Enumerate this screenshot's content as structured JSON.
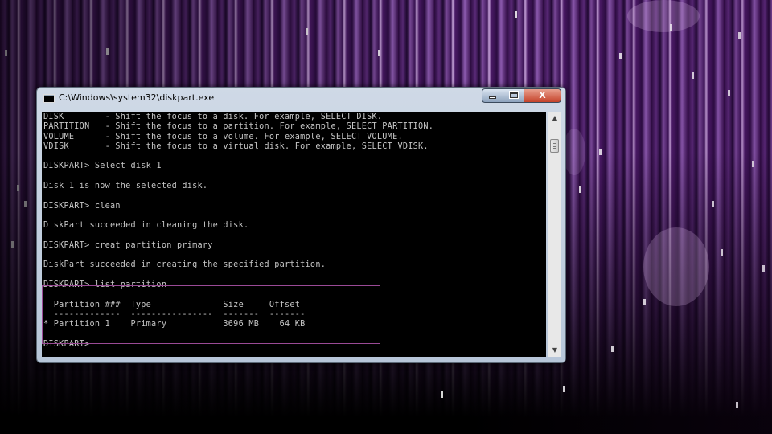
{
  "window": {
    "title": "C:\\Windows\\system32\\diskpart.exe",
    "close_glyph": "X",
    "icon": "console-app-icon"
  },
  "scrollbar": {
    "up_glyph": "▲",
    "down_glyph": "▼"
  },
  "console": {
    "help_lines": [
      "DISK        - Shift the focus to a disk. For example, SELECT DISK.",
      "PARTITION   - Shift the focus to a partition. For example, SELECT PARTITION.",
      "VOLUME      - Shift the focus to a volume. For example, SELECT VOLUME.",
      "VDISK       - Shift the focus to a virtual disk. For example, SELECT VDISK."
    ],
    "cmd_select": "DISKPART> Select disk 1",
    "out_select": "Disk 1 is now the selected disk.",
    "cmd_clean": "DISKPART> clean",
    "out_clean": "DiskPart succeeded in cleaning the disk.",
    "cmd_create": "DISKPART> creat partition primary",
    "out_create": "DiskPart succeeded in creating the specified partition.",
    "cmd_list": "DISKPART> list partition",
    "table_header": "  Partition ###  Type              Size     Offset",
    "table_rule": "  -------------  ----------------  -------  -------",
    "table_row": "* Partition 1    Primary           3696 MB    64 KB",
    "prompt": "DISKPART> "
  },
  "colors": {
    "console_bg": "#000000",
    "console_text": "#c6c6c6",
    "highlight_border": "#9a4a96",
    "close_button": "#c5432a"
  }
}
